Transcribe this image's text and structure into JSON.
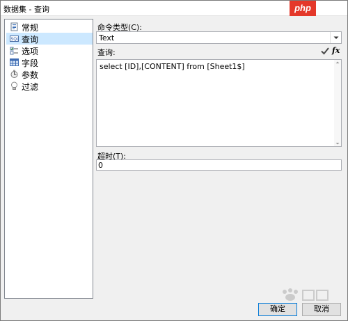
{
  "window": {
    "title": "数据集 - 查询"
  },
  "watermark": {
    "text": "php"
  },
  "tree": {
    "items": [
      {
        "label": "常规",
        "icon": "general-icon",
        "selected": false
      },
      {
        "label": "查询",
        "icon": "query-icon",
        "selected": true
      },
      {
        "label": "选项",
        "icon": "options-icon",
        "selected": false
      },
      {
        "label": "字段",
        "icon": "fields-icon",
        "selected": false
      },
      {
        "label": "参数",
        "icon": "parameters-icon",
        "selected": false
      },
      {
        "label": "过滤",
        "icon": "filter-icon",
        "selected": false
      }
    ]
  },
  "command_type": {
    "label": "命令类型(C):",
    "value": "Text"
  },
  "query": {
    "label": "查询:",
    "text": "select [ID],[CONTENT] from [Sheet1$]",
    "validate_icon": "checkmark-icon",
    "expression_icon": "fx-icon",
    "expression_label": "fx"
  },
  "timeout": {
    "label": "超时(T):",
    "value": "0"
  },
  "buttons": {
    "ok": "确定",
    "cancel": "取消"
  },
  "colors": {
    "selection": "#cce8ff",
    "accent": "#0078d7",
    "watermark": "#e4382a"
  }
}
